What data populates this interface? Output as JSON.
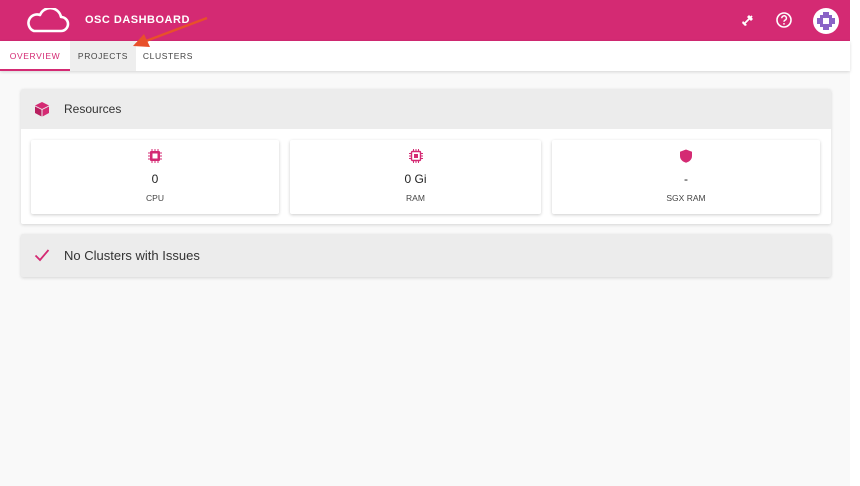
{
  "header": {
    "app_title": "OSC DASHBOARD",
    "icons": [
      "cloud-logo-icon",
      "plug-icon",
      "help-icon",
      "avatar"
    ]
  },
  "tabs": [
    {
      "label": "OVERVIEW",
      "active": true
    },
    {
      "label": "PROJECTS",
      "active": false
    },
    {
      "label": "CLUSTERS",
      "active": false
    }
  ],
  "resources": {
    "title": "Resources",
    "tiles": [
      {
        "value": "0",
        "label": "CPU",
        "icon": "cpu-chip-icon"
      },
      {
        "value": "0 Gi",
        "label": "RAM",
        "icon": "memory-chip-icon"
      },
      {
        "value": "-",
        "label": "SGX RAM",
        "icon": "shield-icon"
      }
    ]
  },
  "issues": {
    "title": "No Clusters with Issues",
    "icon": "check-icon"
  },
  "colors": {
    "brand": "#d42a73",
    "annotation_arrow": "#e8502a"
  }
}
